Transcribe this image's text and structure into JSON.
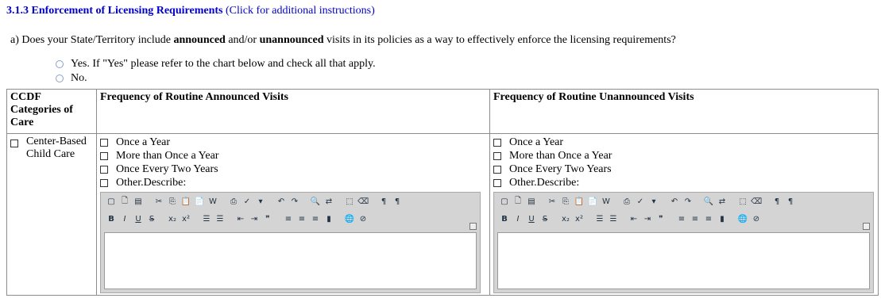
{
  "section": {
    "heading": "3.1.3 Enforcement of Licensing Requirements",
    "link": "(Click for additional instructions)"
  },
  "question": {
    "prefix": "a) Does your State/Territory include ",
    "announced": "announced",
    "andor": " and/or ",
    "unannounced": "unannounced",
    "suffix": " visits in its policies as a way to effectively enforce the licensing requirements?",
    "options": [
      "Yes. If \"Yes\" please refer to the chart below and check all that apply.",
      "No."
    ]
  },
  "table": {
    "headers": [
      "CCDF Categories of Care",
      "Frequency of Routine Announced Visits",
      "Frequency of Routine Unannounced Visits"
    ],
    "category": "Center-Based Child Care",
    "frequencies": [
      "Once a Year",
      "More than Once a Year",
      "Once Every Two Years",
      "Other.Describe:"
    ]
  }
}
